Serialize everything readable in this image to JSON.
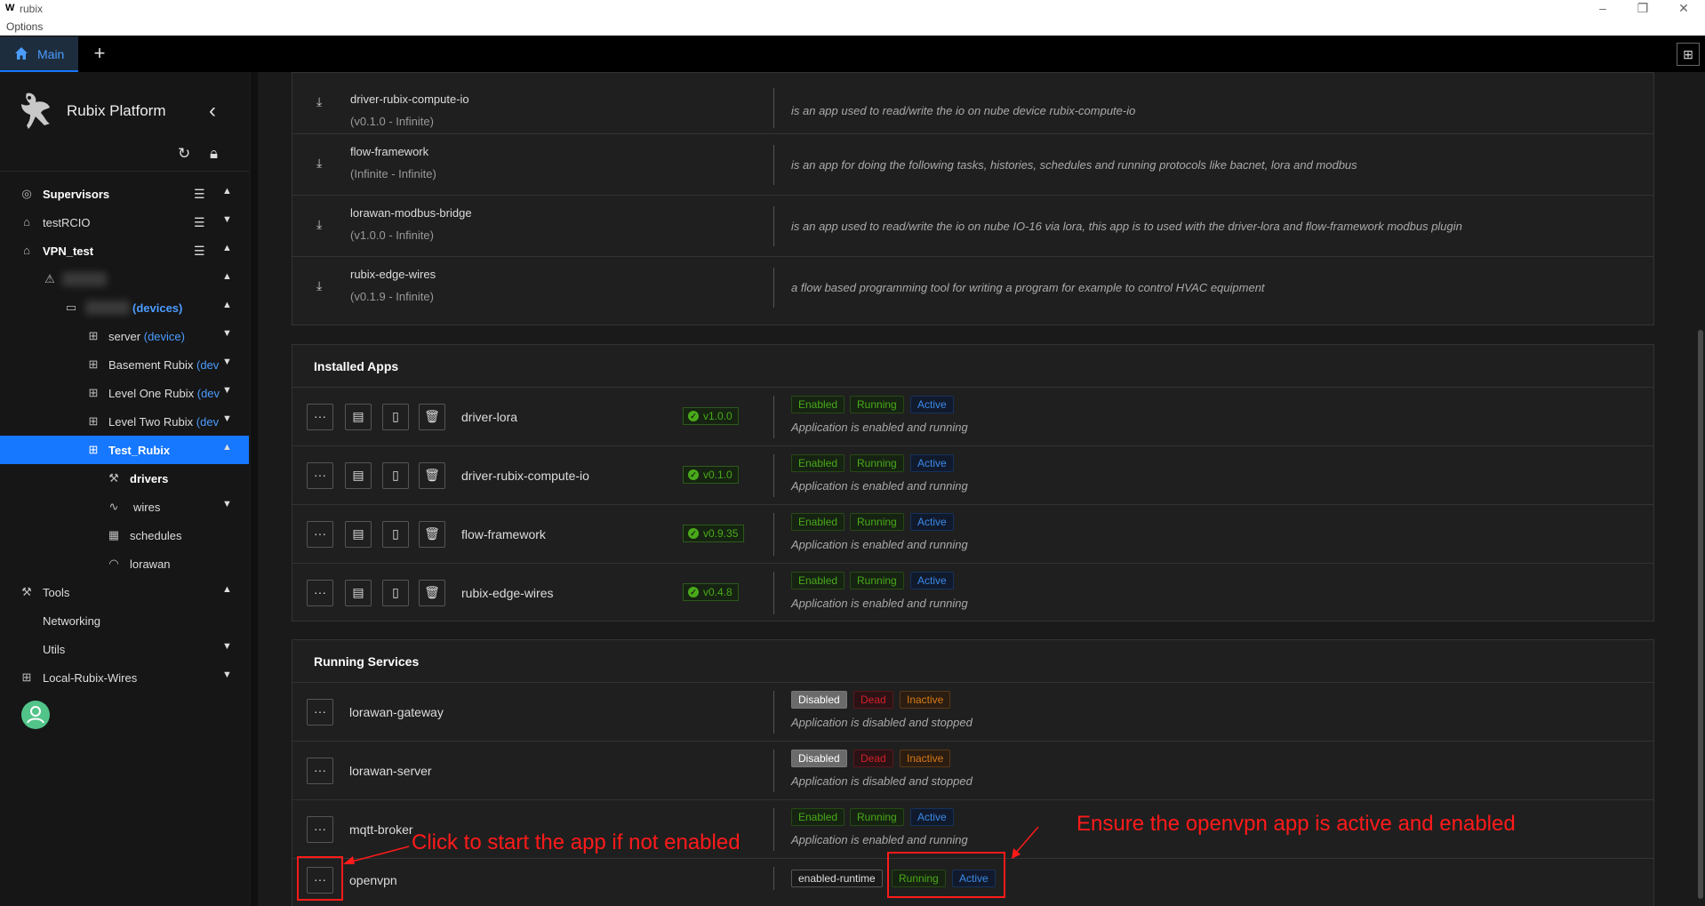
{
  "window": {
    "title": "rubix",
    "logo": "W",
    "menu": "Options",
    "min_icon": "minimize-icon",
    "restore_icon": "restore-icon",
    "close_icon": "close-icon"
  },
  "tabs": {
    "main": "Main",
    "add": "+"
  },
  "sidebar": {
    "brand": "Rubix Platform",
    "items": [
      {
        "label": "Supervisors"
      },
      {
        "label": "testRCIO"
      },
      {
        "label": "VPN_test"
      },
      {
        "label": "(devices)"
      },
      {
        "label": "server",
        "sub": "(device)"
      },
      {
        "label": "Basement Rubix",
        "sub": "(dev"
      },
      {
        "label": "Level One Rubix",
        "sub": "(dev"
      },
      {
        "label": "Level Two Rubix",
        "sub": "(dev"
      },
      {
        "label": "Test_Rubix"
      },
      {
        "label": "drivers"
      },
      {
        "label": "wires"
      },
      {
        "label": "schedules"
      },
      {
        "label": "lorawan"
      },
      {
        "label": "Tools"
      },
      {
        "label": "Networking"
      },
      {
        "label": "Utils"
      },
      {
        "label": "Local-Rubix-Wires"
      }
    ]
  },
  "available_apps": [
    {
      "name": "driver-rubix-compute-io",
      "version": "(v0.1.0 - Infinite)",
      "description": "is an app used to read/write the io on nube device rubix-compute-io"
    },
    {
      "name": "flow-framework",
      "version": "(Infinite - Infinite)",
      "description": "is an app for doing the following tasks, histories, schedules and running protocols like bacnet, lora and modbus"
    },
    {
      "name": "lorawan-modbus-bridge",
      "version": "(v1.0.0 - Infinite)",
      "description": "is an app used to read/write the io on nube IO-16 via lora, this app is to used with the driver-lora and flow-framework modbus plugin"
    },
    {
      "name": "rubix-edge-wires",
      "version": "(v0.1.9 - Infinite)",
      "description": "a flow based programming tool for writing a program for example to control HVAC equipment"
    }
  ],
  "installed": {
    "title": "Installed Apps",
    "apps": [
      {
        "name": "driver-lora",
        "version": "v1.0.0",
        "tags": [
          "Enabled",
          "Running",
          "Active"
        ],
        "status": "Application is enabled and running"
      },
      {
        "name": "driver-rubix-compute-io",
        "version": "v0.1.0",
        "tags": [
          "Enabled",
          "Running",
          "Active"
        ],
        "status": "Application is enabled and running"
      },
      {
        "name": "flow-framework",
        "version": "v0.9.35",
        "tags": [
          "Enabled",
          "Running",
          "Active"
        ],
        "status": "Application is enabled and running"
      },
      {
        "name": "rubix-edge-wires",
        "version": "v0.4.8",
        "tags": [
          "Enabled",
          "Running",
          "Active"
        ],
        "status": "Application is enabled and running"
      }
    ]
  },
  "services": {
    "title": "Running Services",
    "items": [
      {
        "name": "lorawan-gateway",
        "tags": [
          "Disabled",
          "Dead",
          "Inactive"
        ],
        "status": "Application is disabled and stopped"
      },
      {
        "name": "lorawan-server",
        "tags": [
          "Disabled",
          "Dead",
          "Inactive"
        ],
        "status": "Application is disabled and stopped"
      },
      {
        "name": "mqtt-broker",
        "tags": [
          "Enabled",
          "Running",
          "Active"
        ],
        "status": "Application is enabled and running"
      },
      {
        "name": "openvpn",
        "tags": [
          "enabled-runtime",
          "Running",
          "Active"
        ],
        "status": ""
      }
    ]
  },
  "annotations": {
    "left": "Click to start the app if not enabled",
    "right": "Ensure the openvpn app is active and enabled"
  },
  "buttons": {
    "more": "···"
  },
  "colors": {
    "accent": "#1677ff",
    "annotation": "#ff1a1a",
    "success": "#49aa19"
  }
}
